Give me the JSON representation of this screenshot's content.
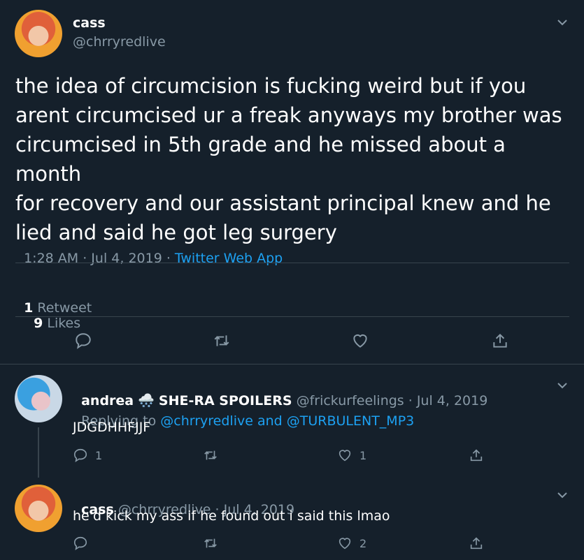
{
  "main_tweet": {
    "author_name": "cass",
    "author_handle": "@chrryredlive",
    "text_lines": [
      "the idea of circumcision is fucking weird but if you",
      "arent circumcised ur a freak anyways my brother was",
      "circumcised in 5th grade and he missed about a month",
      "for recovery and our assistant principal knew and he",
      "lied and said he got leg surgery"
    ],
    "time": "1:28 AM · Jul 4, 2019 · ",
    "source": "Twitter Web App",
    "retweets_count": "1",
    "retweets_label": " Retweet",
    "likes_count": "9",
    "likes_label": " Likes"
  },
  "reply1": {
    "name": "andrea",
    "name_emoji": "🌨️",
    "name_suffix": "SHE-RA SPOILERS",
    "handle_date": "@frickurfeelings · Jul 4, 2019",
    "replying_prefix": "Replying to ",
    "replying_mentions": "@chrryredlive and @TURBULENT_MP3",
    "text": "JDGDHHFJJF",
    "reply_count": "1",
    "like_count": "1"
  },
  "reply2": {
    "name": "cass",
    "handle_date": "@chrryredlive · Jul 4, 2019",
    "text": "he'd kick my ass if he found out i said this lmao",
    "like_count": "2"
  },
  "colors": {
    "background": "#15202b",
    "muted": "#8899a6",
    "accent": "#1da1f2",
    "divider": "#38444d"
  }
}
